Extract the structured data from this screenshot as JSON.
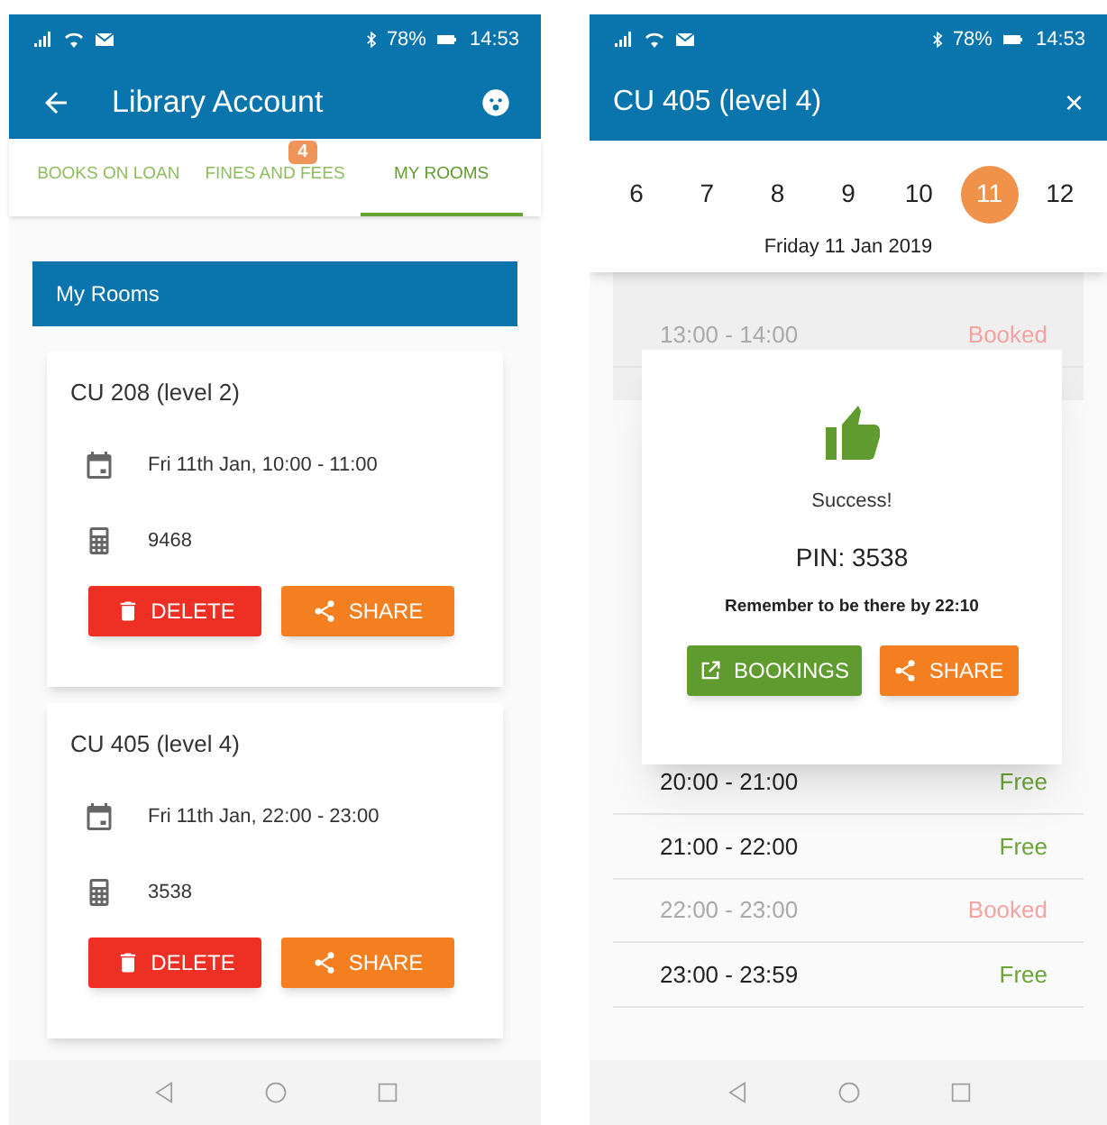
{
  "left_screen": {
    "status_bar": {
      "battery": "78%",
      "time": "14:53"
    },
    "app_bar": {
      "title": "Library Account"
    },
    "tabs": [
      {
        "label": "BOOKS ON LOAN",
        "selected": false
      },
      {
        "label": "FINES AND FEES",
        "selected": false,
        "badge": "4"
      },
      {
        "label": "MY ROOMS",
        "selected": true
      }
    ],
    "section_title": "My Rooms",
    "rooms": [
      {
        "name": "CU 208 (level 2)",
        "when": "Fri 11th Jan, 10:00 - 11:00",
        "pin": "9468",
        "buttons": [
          "DELETE",
          "SHARE"
        ]
      },
      {
        "name": "CU 405 (level 4)",
        "when": "Fri 11th Jan, 22:00 - 23:00",
        "pin": "3538",
        "buttons": [
          "DELETE",
          "SHARE"
        ]
      }
    ]
  },
  "right_screen": {
    "status_bar": {
      "battery": "78%",
      "time": "14:53"
    },
    "app_bar": {
      "title": "CU 405 (level 4)",
      "close": "×"
    },
    "days": [
      {
        "label": "6",
        "selected": false
      },
      {
        "label": "7",
        "selected": false
      },
      {
        "label": "8",
        "selected": false
      },
      {
        "label": "9",
        "selected": false
      },
      {
        "label": "10",
        "selected": false
      },
      {
        "label": "11",
        "selected": true
      },
      {
        "label": "12",
        "selected": false
      }
    ],
    "date": "Friday 11 Jan 2019",
    "slots": [
      {
        "time": "13:00 - 14:00",
        "status": "Booked",
        "booked": true
      },
      {
        "time": "20:00 - 21:00",
        "status": "Free",
        "booked": false
      },
      {
        "time": "21:00 - 22:00",
        "status": "Free",
        "booked": false
      },
      {
        "time": "22:00 - 23:00",
        "status": "Booked",
        "booked": true
      },
      {
        "time": "23:00 - 23:59",
        "status": "Free",
        "booked": false
      }
    ],
    "dialog": {
      "title": "Success!",
      "pin": "PIN: 3538",
      "note": "Remember to be there by 22:10",
      "buttons": [
        "BOOKINGS",
        "SHARE"
      ]
    }
  }
}
